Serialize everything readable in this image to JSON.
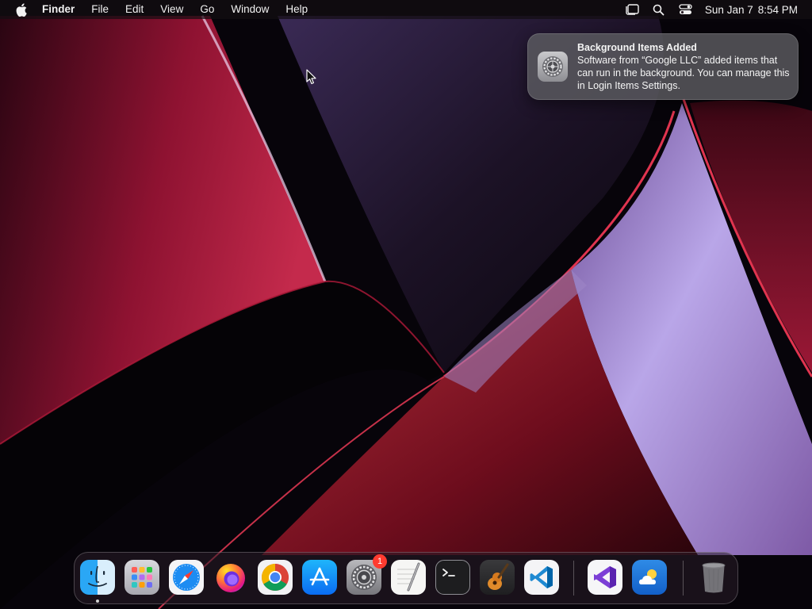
{
  "menubar": {
    "app_name": "Finder",
    "menus": [
      "File",
      "Edit",
      "View",
      "Go",
      "Window",
      "Help"
    ],
    "status_icons": [
      "stage-manager-icon",
      "spotlight-search-icon",
      "control-center-icon"
    ],
    "date": "Sun Jan 7",
    "time": "8:54 PM"
  },
  "notification": {
    "app_icon": "system-settings-icon",
    "title": "Background Items Added",
    "body": "Software from “Google LLC” added items that can run in the background. You can manage this in Login Items Settings."
  },
  "dock": {
    "apps": [
      {
        "name": "Finder",
        "icon": "finder-icon",
        "running": true
      },
      {
        "name": "Launchpad",
        "icon": "launchpad-icon"
      },
      {
        "name": "Safari",
        "icon": "safari-icon"
      },
      {
        "name": "Firefox",
        "icon": "firefox-icon"
      },
      {
        "name": "Google Chrome",
        "icon": "chrome-icon"
      },
      {
        "name": "App Store",
        "icon": "app-store-icon"
      },
      {
        "name": "System Settings",
        "icon": "system-settings-icon",
        "badge": "1"
      },
      {
        "name": "TextEdit",
        "icon": "textedit-icon"
      },
      {
        "name": "Terminal",
        "icon": "terminal-icon"
      },
      {
        "name": "GarageBand",
        "icon": "garageband-icon"
      },
      {
        "name": "Visual Studio Code",
        "icon": "vscode-icon"
      },
      {
        "name": "Visual Studio",
        "icon": "visual-studio-icon"
      },
      {
        "name": "Weather",
        "icon": "weather-icon"
      },
      {
        "name": "Trash",
        "icon": "trash-icon"
      }
    ]
  },
  "colors": {
    "accent_red": "#c0183a",
    "wallpaper_dark": "#07040a",
    "wallpaper_lavender": "#b9a6e8",
    "badge_red": "#ff3b30"
  }
}
